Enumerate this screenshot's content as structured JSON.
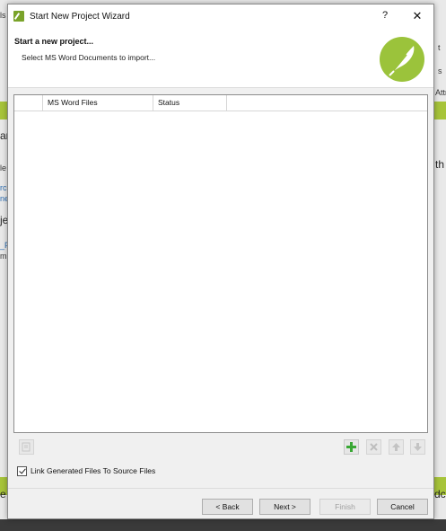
{
  "background": {
    "fragments": [
      "ls",
      "t",
      "s",
      "Attr",
      "ar",
      "le",
      "rc",
      "ne",
      "je",
      "th",
      "_F",
      "m",
      "e",
      "dc"
    ]
  },
  "dialog": {
    "title": "Start New Project Wizard",
    "help_label": "?",
    "close_label": "✕",
    "header_title": "Start a new project...",
    "header_subtitle": "Select MS Word Documents to import...",
    "table": {
      "columns": [
        "",
        "MS Word Files",
        "Status"
      ],
      "rows": []
    },
    "link_checkbox": {
      "label": "Link Generated Files To Source Files",
      "checked": true
    },
    "buttons": {
      "back": "< Back",
      "next": "Next >",
      "finish": "Finish",
      "cancel": "Cancel"
    },
    "colors": {
      "brand_green": "#9bc33b",
      "add_green": "#3aa835"
    },
    "icons": {
      "edit": "edit-icon",
      "add": "add-icon",
      "remove": "remove-icon",
      "up": "arrow-up-icon",
      "down": "arrow-down-icon"
    }
  }
}
